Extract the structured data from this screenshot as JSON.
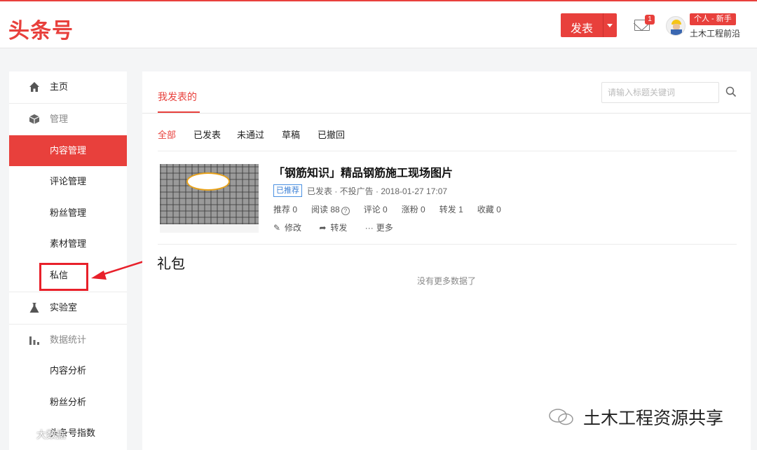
{
  "header": {
    "logo": "头条号",
    "publish_label": "发表",
    "mail_count": "1",
    "level_badge": "个人 - 新手",
    "username": "土木工程前沿"
  },
  "sidebar": {
    "items": [
      {
        "label": "主页",
        "icon": "home-icon"
      },
      {
        "label": "管理",
        "icon": "cube-icon"
      },
      {
        "label": "内容管理"
      },
      {
        "label": "评论管理"
      },
      {
        "label": "粉丝管理"
      },
      {
        "label": "素材管理"
      },
      {
        "label": "私信"
      },
      {
        "label": "实验室",
        "icon": "flask-icon"
      },
      {
        "label": "数据统计",
        "icon": "bar-chart-icon"
      },
      {
        "label": "内容分析"
      },
      {
        "label": "粉丝分析"
      },
      {
        "label": "头条号指数"
      }
    ]
  },
  "main": {
    "tab": "我发表的",
    "search_placeholder": "请输入标题关键词",
    "filters": [
      "全部",
      "已发表",
      "未通过",
      "草稿",
      "已撤回"
    ],
    "post": {
      "title": "「钢筋知识」精品钢筋施工现场图片",
      "badge": "已推荐",
      "meta": "已发表 · 不投广告 · 2018-01-27 17:07",
      "stats": {
        "recommend": "推荐 0",
        "reads": "阅读 88",
        "comments": "评论 0",
        "followers": "涨粉 0",
        "shares": "转发 1",
        "favorites": "收藏 0"
      },
      "actions": {
        "edit": "修改",
        "share": "转发",
        "more": "更多"
      }
    },
    "no_more": "没有更多数据了"
  },
  "annotation": "礼包",
  "watermark": "土木工程资源共享",
  "corner_watermark": "大数据"
}
